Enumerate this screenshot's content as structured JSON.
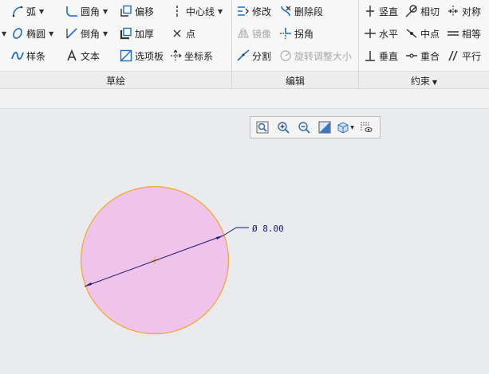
{
  "ribbon": {
    "groups": {
      "sketch": "草绘",
      "edit": "编辑",
      "constrain": "约束"
    },
    "sketch_tools": {
      "arc": "弧",
      "fillet": "圆角",
      "offset": "偏移",
      "centerline": "中心线",
      "ellipse": "椭圆",
      "chamfer": "倒角",
      "thicken": "加厚",
      "point": "点",
      "spline": "样条",
      "text": "文本",
      "palette": "选项板",
      "coord_system": "坐标系"
    },
    "edit_tools": {
      "modify": "修改",
      "delete_segment": "删除段",
      "mirror": "镜像",
      "corner": "拐角",
      "divide": "分割",
      "rotate_resize": "旋转调整大小"
    },
    "constrain_tools": {
      "vertical": "竖直",
      "tangent": "相切",
      "symmetric": "对称",
      "horizontal": "水平",
      "midpoint": "中点",
      "equal": "相等",
      "perpendicular": "垂直",
      "coincident": "重合",
      "parallel": "平行"
    }
  },
  "view_toolbar": {
    "icons": [
      "zoom-fit-icon",
      "zoom-in-icon",
      "zoom-out-icon",
      "repaint-icon",
      "display-style-icon",
      "sketch-display-icon"
    ]
  },
  "canvas": {
    "dimension_label": "Ø 8.00",
    "circle_fill": "#efc3ea",
    "circle_stroke": "#f5a623",
    "dimension_color": "#1a1a70"
  }
}
